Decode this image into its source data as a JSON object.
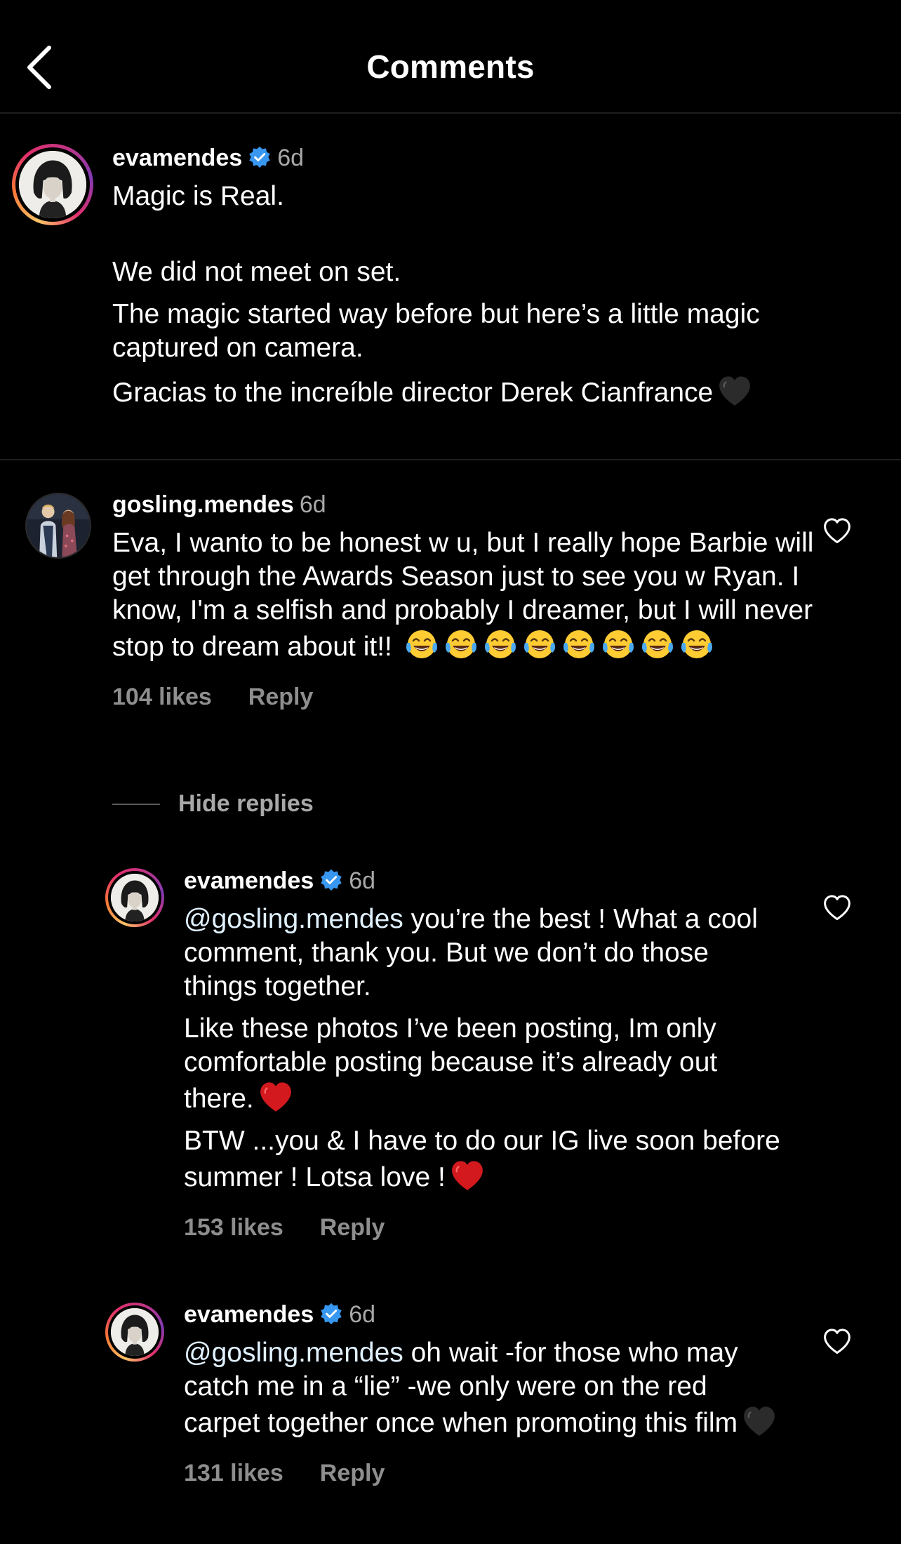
{
  "header": {
    "title": "Comments",
    "back_icon": "chevron-left-icon"
  },
  "caption": {
    "username": "evamendes",
    "verified": true,
    "time": "6d",
    "paragraphs": [
      "Magic is Real.",
      "We did not meet on set.",
      "The magic started way before but here’s a little magic captured on camera.",
      "Gracias to the increíble director Derek Cianfrance"
    ],
    "emoji": "black-heart"
  },
  "comments": [
    {
      "username": "gosling.mendes",
      "time": "6d",
      "text": "Eva, I wanto to be honest w u, but I really hope Barbie will get through the Awards Season just to see you w Ryan. I know, I'm a selfish and probably I dreamer, but I will never stop to dream about it!!",
      "emoji": "face-with-tears-of-joy",
      "emoji_count": 8,
      "likes": "104 likes",
      "reply_label": "Reply",
      "hide_replies_label": "Hide replies",
      "replies": [
        {
          "username": "evamendes",
          "verified": true,
          "time": "6d",
          "mention": "@gosling.mendes",
          "paragraphs": [
            "you’re the best ! What a cool comment, thank you. But we don’t do those things together.",
            "Like these photos I’ve been posting, Im only comfortable posting because it’s already out there.",
            "BTW ...you & I have to do our IG live soon before summer ! Lotsa love !"
          ],
          "emoji": "red-heart",
          "likes": "153 likes",
          "reply_label": "Reply"
        },
        {
          "username": "evamendes",
          "verified": true,
          "time": "6d",
          "mention": "@gosling.mendes",
          "paragraphs": [
            "oh wait -for those who may catch me in a “lie” -we only were on the red carpet together once when promoting this film"
          ],
          "emoji": "black-heart",
          "likes": "131 likes",
          "reply_label": "Reply"
        }
      ]
    }
  ],
  "colors": {
    "background": "#000000",
    "text": "#ffffff",
    "secondary": "#a8a8a8",
    "verified": "#3897f0",
    "mention": "#e0f1ff",
    "divider": "#1e1e1e"
  }
}
